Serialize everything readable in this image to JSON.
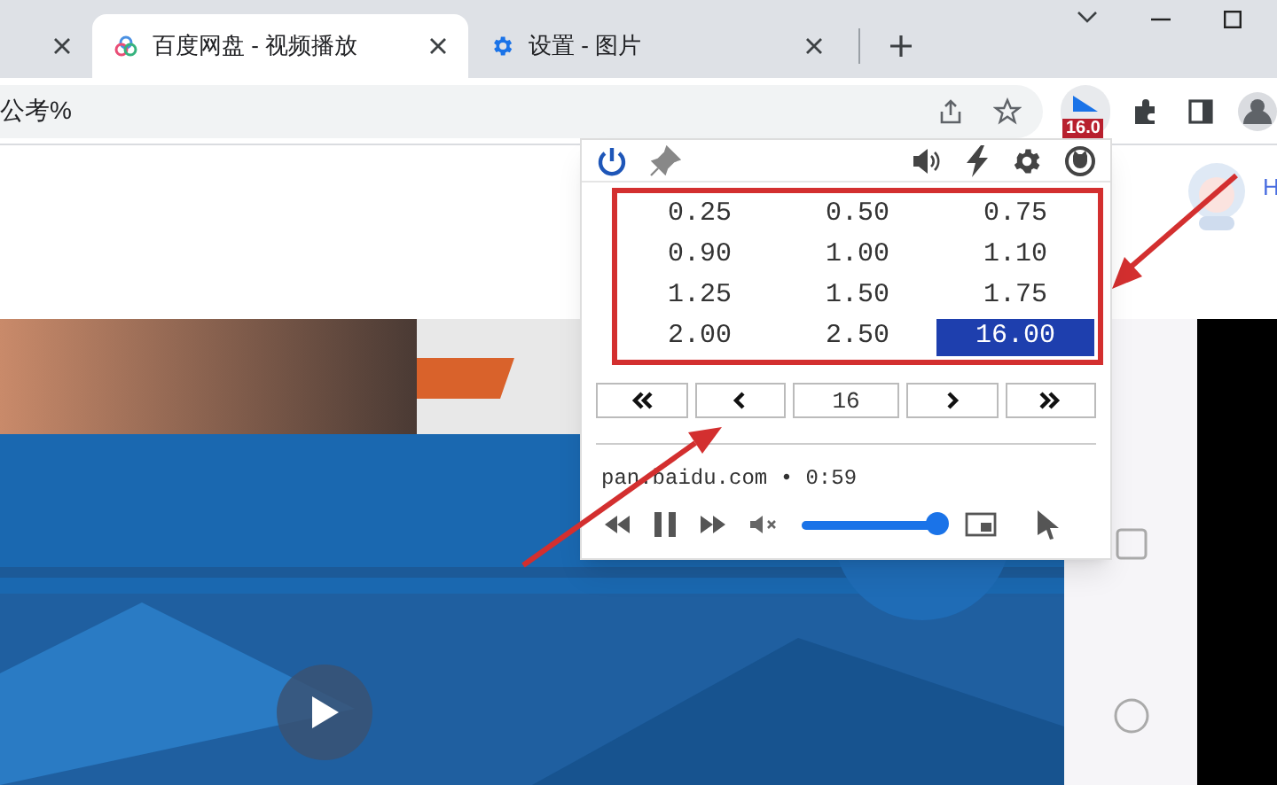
{
  "tabs": [
    {
      "selected": false
    },
    {
      "title": "百度网盘 - 视频播放",
      "selected": true
    },
    {
      "title": "设置 - 图片",
      "selected": false
    }
  ],
  "address_bar": {
    "value": "公考%"
  },
  "extension_badge": "16.0",
  "page": {
    "avatar_label": "H"
  },
  "popup": {
    "speeds": [
      {
        "label": "0.25",
        "selected": false
      },
      {
        "label": "0.50",
        "selected": false
      },
      {
        "label": "0.75",
        "selected": false
      },
      {
        "label": "0.90",
        "selected": false
      },
      {
        "label": "1.00",
        "selected": false
      },
      {
        "label": "1.10",
        "selected": false
      },
      {
        "label": "1.25",
        "selected": false
      },
      {
        "label": "1.50",
        "selected": false
      },
      {
        "label": "1.75",
        "selected": false
      },
      {
        "label": "2.00",
        "selected": false
      },
      {
        "label": "2.50",
        "selected": false
      },
      {
        "label": "16.00",
        "selected": true
      }
    ],
    "speed_field": {
      "value": "16"
    },
    "media": {
      "source": "pan.baidu.com • 0:59",
      "volume": {
        "level": 0.96
      }
    }
  }
}
